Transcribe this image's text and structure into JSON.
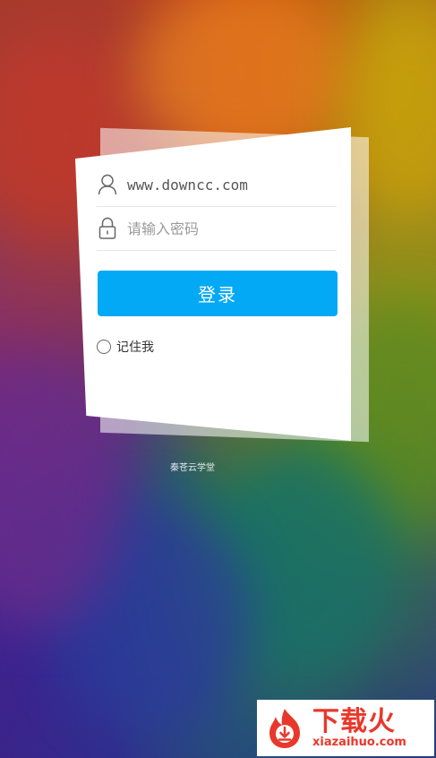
{
  "login": {
    "username_value": "www.downcc.com",
    "password_placeholder": "请输入密码",
    "login_label": "登录",
    "remember_label": "记住我"
  },
  "footer": {
    "text": "秦苍云学堂"
  },
  "watermark": {
    "brand_cn": "下载火",
    "brand_en": "xiazaihuo.com"
  },
  "colors": {
    "accent": "#03a9f4",
    "watermark_red": "#e8382b"
  },
  "icons": {
    "username": "user-icon",
    "password": "lock-icon",
    "watermark": "flame-download-icon"
  }
}
